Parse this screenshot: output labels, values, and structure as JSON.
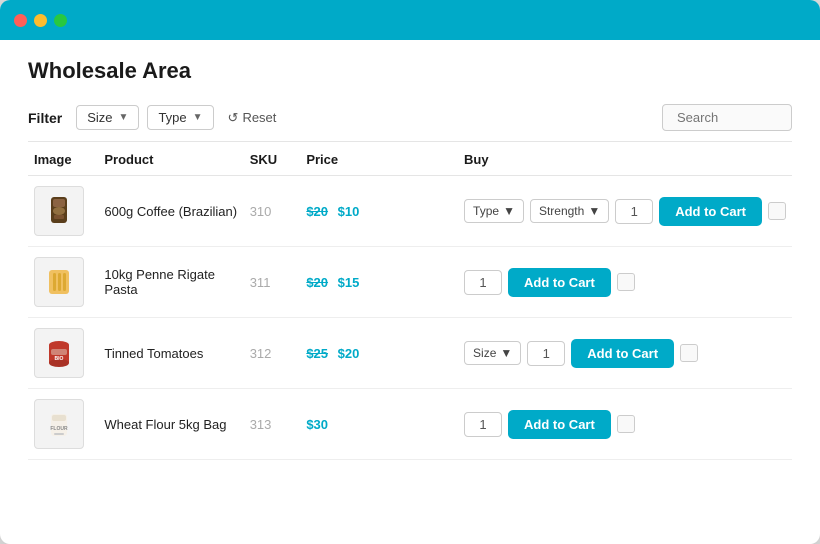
{
  "window": {
    "title": "Wholesale Area"
  },
  "titlebar": {
    "dots": [
      "red",
      "yellow",
      "green"
    ]
  },
  "header": {
    "page_title": "Wholesale Area"
  },
  "filter": {
    "label": "Filter",
    "size_label": "Size",
    "type_label": "Type",
    "reset_label": "Reset",
    "search_placeholder": "Search"
  },
  "table": {
    "columns": [
      "Image",
      "Product",
      "SKU",
      "Price",
      "Buy"
    ],
    "rows": [
      {
        "id": 1,
        "product": "600g Coffee (Brazilian)",
        "sku": "310",
        "price_old": "$20",
        "price_new": "$10",
        "has_type_dropdown": true,
        "type_label": "Type",
        "has_strength_dropdown": true,
        "strength_label": "Strength",
        "qty": "1",
        "add_to_cart": "Add to Cart",
        "img_type": "coffee"
      },
      {
        "id": 2,
        "product": "10kg Penne Rigate Pasta",
        "sku": "311",
        "price_old": "$20",
        "price_new": "$15",
        "has_type_dropdown": false,
        "has_strength_dropdown": false,
        "qty": "1",
        "add_to_cart": "Add to Cart",
        "img_type": "pasta"
      },
      {
        "id": 3,
        "product": "Tinned Tomatoes",
        "sku": "312",
        "price_old": "$25",
        "price_new": "$20",
        "has_type_dropdown": false,
        "has_size_dropdown": true,
        "size_label": "Size",
        "has_strength_dropdown": false,
        "qty": "1",
        "add_to_cart": "Add to Cart",
        "img_type": "tin"
      },
      {
        "id": 4,
        "product": "Wheat Flour 5kg Bag",
        "sku": "313",
        "price_only": "$30",
        "has_type_dropdown": false,
        "has_strength_dropdown": false,
        "qty": "1",
        "add_to_cart": "Add to Cart",
        "img_type": "flour"
      }
    ]
  }
}
